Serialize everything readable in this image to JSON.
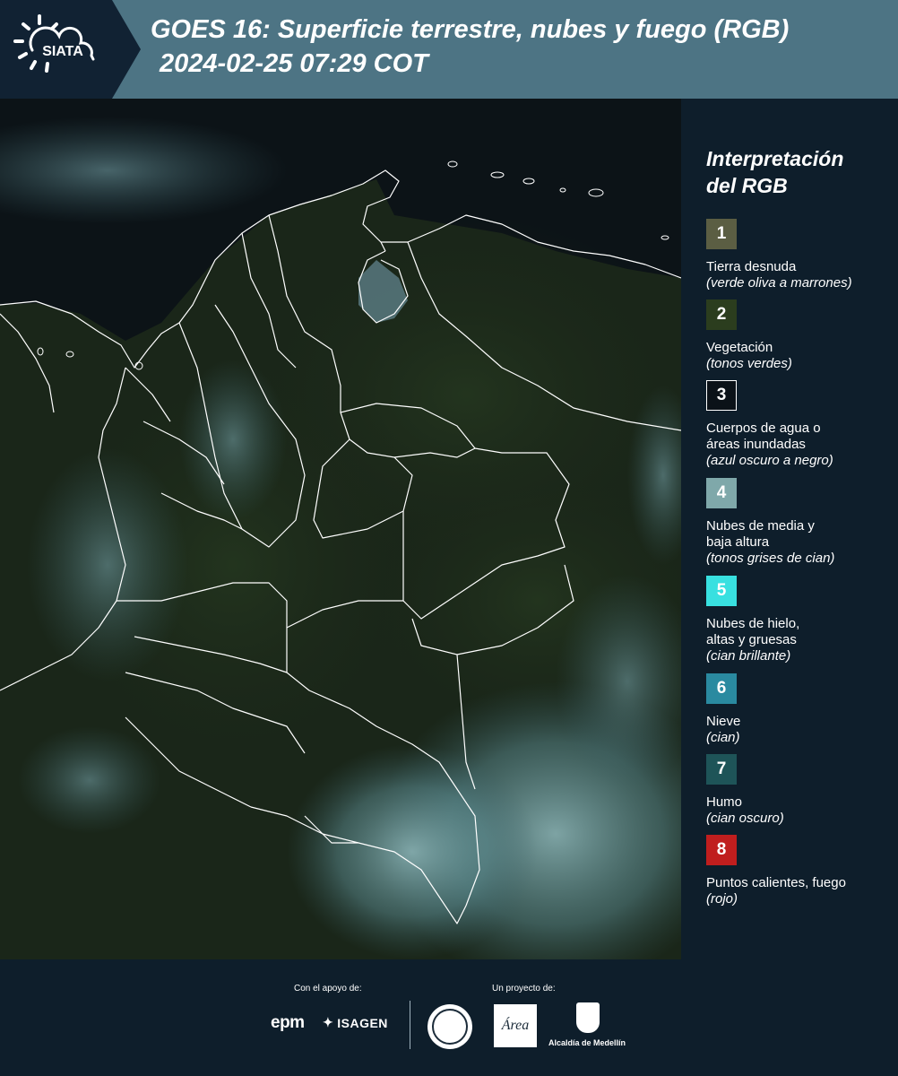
{
  "header": {
    "logo_text": "SIATA",
    "title_line1": "GOES 16: Superficie terrestre, nubes y fuego (RGB)",
    "title_line2": "2024-02-25 07:29 COT"
  },
  "legend": {
    "title_line1": "Interpretación",
    "title_line2": "del RGB",
    "items": [
      {
        "number": "1",
        "color": "#5b5e43",
        "lines": [
          "Tierra desnuda"
        ],
        "sub": "(verde oliva a marrones)"
      },
      {
        "number": "2",
        "color": "#2b3d1e",
        "lines": [
          "Vegetación"
        ],
        "sub": "(tonos verdes)"
      },
      {
        "number": "3",
        "color": "#0b1218",
        "lines": [
          "Cuerpos de agua o",
          "áreas inundadas"
        ],
        "sub": "(azul oscuro a negro)"
      },
      {
        "number": "4",
        "color": "#7fa8aa",
        "lines": [
          "Nubes de media y",
          "baja altura"
        ],
        "sub": "(tonos grises de cian)"
      },
      {
        "number": "5",
        "color": "#38e0e0",
        "lines": [
          "Nubes de hielo,",
          "altas y gruesas"
        ],
        "sub": "(cian brillante)"
      },
      {
        "number": "6",
        "color": "#2a8aa0",
        "lines": [
          "Nieve"
        ],
        "sub": "(cian)"
      },
      {
        "number": "7",
        "color": "#1e5458",
        "lines": [
          "Humo"
        ],
        "sub": "(cian oscuro)"
      },
      {
        "number": "8",
        "color": "#c01e1e",
        "lines": [
          "Puntos calientes, fuego"
        ],
        "sub": "(rojo)"
      }
    ]
  },
  "footer": {
    "support_label": "Con el apoyo de:",
    "project_label": "Un proyecto de:",
    "epm": "epm",
    "isagen": "ISAGEN",
    "area_logo": "Área",
    "alcaldia": "Alcaldía de Medellín"
  },
  "colors": {
    "header_bg": "#4d7484",
    "panel_bg": "#0e1e2b",
    "border_line": "#ffffff"
  }
}
